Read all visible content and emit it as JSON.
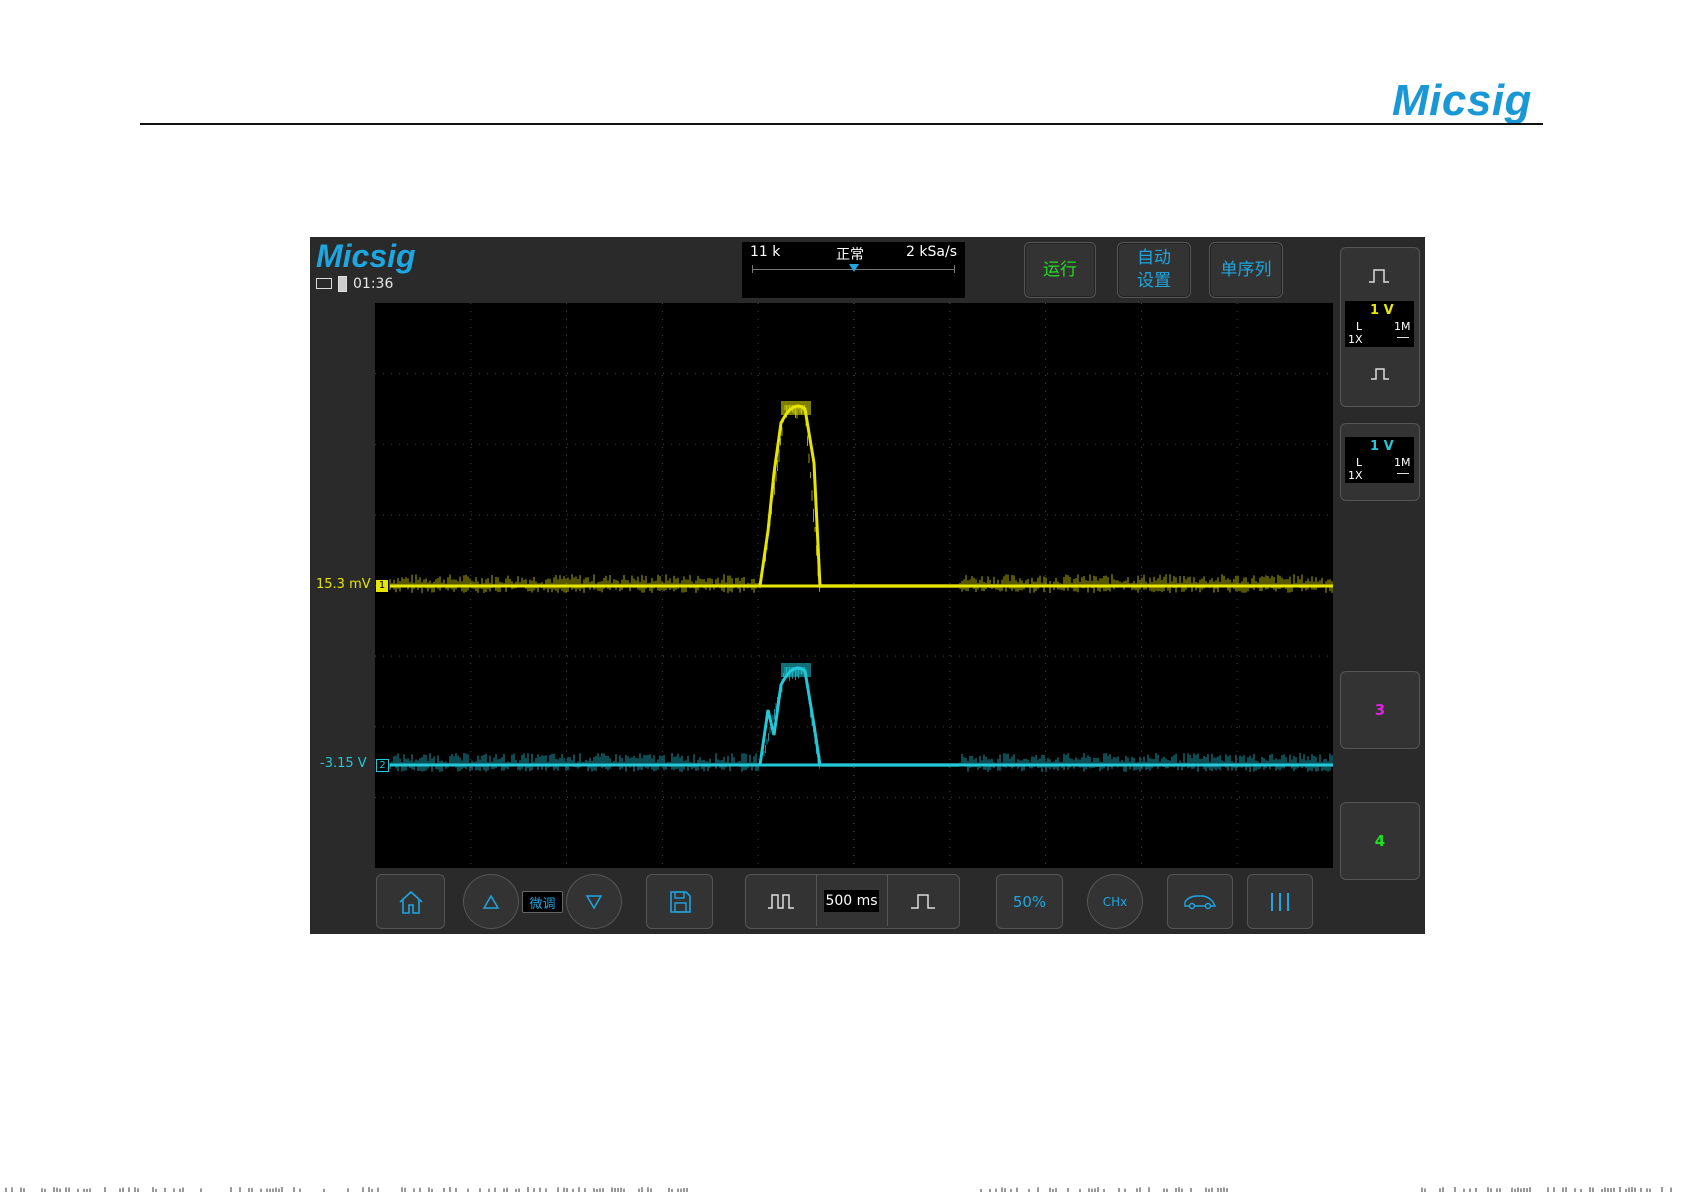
{
  "page": {
    "logo": "Micsig"
  },
  "scope": {
    "logo": "Micsig",
    "time": "01:36",
    "timebar": {
      "points": "11 k",
      "mode": "正常",
      "sample_rate": "2 kSa/s"
    },
    "buttons": {
      "run": "运行",
      "auto_line1": "自动",
      "auto_line2": "设置",
      "single": "单序列"
    },
    "channels": [
      {
        "id": "1",
        "level_label": "15.3 mV",
        "color": "#e6e600",
        "scale": "1 V",
        "coupling": "L",
        "impedance": "1M",
        "probe": "1X"
      },
      {
        "id": "2",
        "level_label": "-3.15 V",
        "color": "#22c8d8",
        "scale": "1 V",
        "coupling": "L",
        "impedance": "1M",
        "probe": "1X"
      }
    ],
    "ch3_label": "3",
    "ch3_color": "#e020e0",
    "ch4_label": "4",
    "ch4_color": "#22dd22",
    "bottom": {
      "fine_label": "微调",
      "timebase": "500 ms",
      "percent": "50%",
      "chx": "CHx"
    },
    "icons": [
      "home-icon",
      "up-triangle-icon",
      "down-triangle-icon",
      "save-icon",
      "pulse-wide-icon",
      "pulse-narrow-icon",
      "car-icon",
      "menu-bars-icon"
    ]
  }
}
